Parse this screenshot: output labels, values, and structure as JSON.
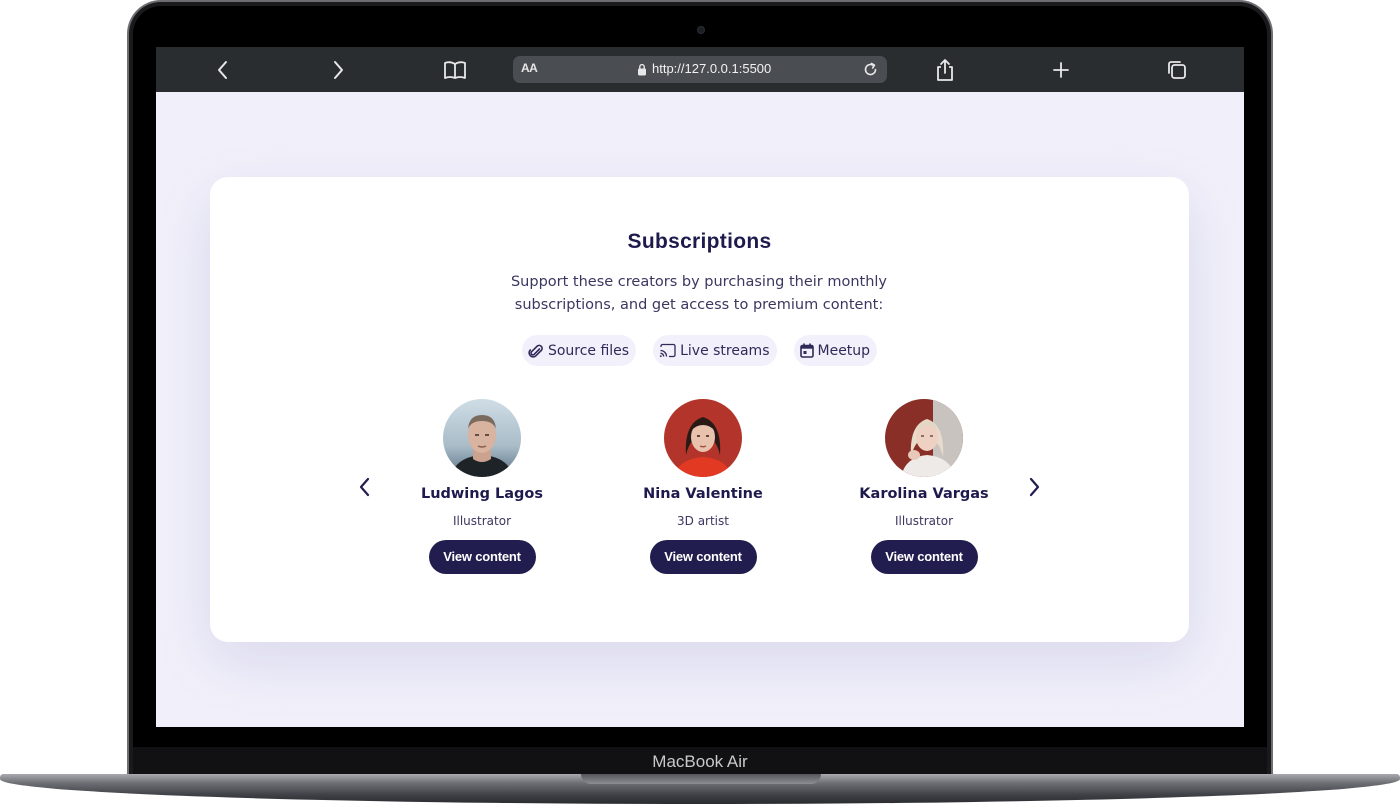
{
  "device": {
    "brand_label": "MacBook Air"
  },
  "browser": {
    "url": "http://127.0.0.1:5500",
    "text_size_label": "AA",
    "icons": [
      "chevron-left-icon",
      "chevron-right-icon",
      "book-icon",
      "lock-icon",
      "reload-icon",
      "share-icon",
      "plus-icon",
      "tabs-icon"
    ]
  },
  "card": {
    "title": "Subscriptions",
    "description": "Support these creators by purchasing their monthly subscriptions, and get access to premium content:",
    "features": [
      {
        "label": "Source files",
        "icon": "paperclip-icon"
      },
      {
        "label": "Live streams",
        "icon": "cast-icon"
      },
      {
        "label": "Meetup",
        "icon": "calendar-icon"
      }
    ],
    "creators": [
      {
        "name": "Ludwing Lagos",
        "role": "Illustrator",
        "button": "View content"
      },
      {
        "name": "Nina Valentine",
        "role": "3D artist",
        "button": "View content"
      },
      {
        "name": "Karolina Vargas",
        "role": "Illustrator",
        "button": "View content"
      }
    ]
  },
  "colors": {
    "primary": "#211d4f",
    "page_background": "#f1f0fa",
    "chip_background": "#f2f0fb",
    "browser_toolbar": "#2a2d30"
  }
}
